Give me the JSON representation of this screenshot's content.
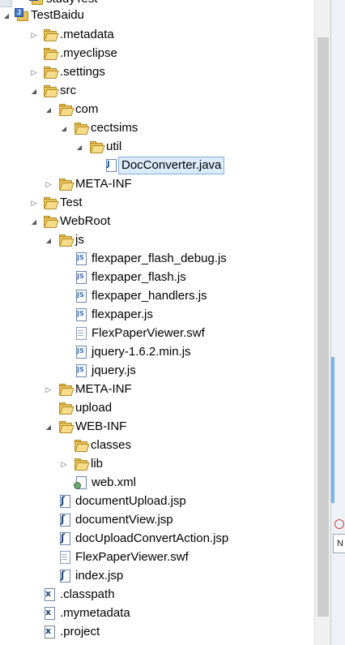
{
  "tree": {
    "partial_top_item": "studyTest",
    "items": [
      {
        "label": "TestBaidu",
        "icon": "project-icon",
        "state": "expanded"
      },
      {
        "label": ".metadata",
        "icon": "folder-icon",
        "state": "collapsed"
      },
      {
        "label": ".myeclipse",
        "icon": "folder-icon",
        "state": "none"
      },
      {
        "label": ".settings",
        "icon": "folder-icon",
        "state": "collapsed"
      },
      {
        "label": "src",
        "icon": "folder-icon",
        "state": "expanded"
      },
      {
        "label": "com",
        "icon": "folder-icon",
        "state": "expanded"
      },
      {
        "label": "cectsims",
        "icon": "folder-icon",
        "state": "expanded"
      },
      {
        "label": "util",
        "icon": "folder-icon",
        "state": "expanded"
      },
      {
        "label": "DocConverter.java",
        "icon": "java-file-icon",
        "state": "none",
        "selected": true
      },
      {
        "label": "META-INF",
        "icon": "folder-icon",
        "state": "collapsed"
      },
      {
        "label": "Test",
        "icon": "folder-icon",
        "state": "collapsed"
      },
      {
        "label": "WebRoot",
        "icon": "folder-icon",
        "state": "expanded"
      },
      {
        "label": "js",
        "icon": "folder-icon",
        "state": "expanded"
      },
      {
        "label": "flexpaper_flash_debug.js",
        "icon": "js-file-icon",
        "state": "none"
      },
      {
        "label": "flexpaper_flash.js",
        "icon": "js-file-icon",
        "state": "none"
      },
      {
        "label": "flexpaper_handlers.js",
        "icon": "js-file-icon",
        "state": "none"
      },
      {
        "label": "flexpaper.js",
        "icon": "js-file-icon",
        "state": "none"
      },
      {
        "label": "FlexPaperViewer.swf",
        "icon": "swf-file-icon",
        "state": "none"
      },
      {
        "label": "jquery-1.6.2.min.js",
        "icon": "js-file-icon",
        "state": "none"
      },
      {
        "label": "jquery.js",
        "icon": "js-file-icon",
        "state": "none"
      },
      {
        "label": "META-INF",
        "icon": "folder-icon",
        "state": "collapsed"
      },
      {
        "label": "upload",
        "icon": "folder-icon",
        "state": "none"
      },
      {
        "label": "WEB-INF",
        "icon": "folder-icon",
        "state": "expanded"
      },
      {
        "label": "classes",
        "icon": "folder-icon",
        "state": "none"
      },
      {
        "label": "lib",
        "icon": "folder-icon",
        "state": "collapsed"
      },
      {
        "label": "web.xml",
        "icon": "xml-file-icon",
        "state": "none"
      },
      {
        "label": "documentUpload.jsp",
        "icon": "jsp-file-icon",
        "state": "none"
      },
      {
        "label": "documentView.jsp",
        "icon": "jsp-file-icon",
        "state": "none"
      },
      {
        "label": "docUploadConvertAction.jsp",
        "icon": "jsp-file-icon",
        "state": "none"
      },
      {
        "label": "FlexPaperViewer.swf",
        "icon": "swf-file-icon",
        "state": "none"
      },
      {
        "label": "index.jsp",
        "icon": "jsp-file-icon",
        "state": "none"
      },
      {
        "label": ".classpath",
        "icon": "x-file-icon",
        "state": "none"
      },
      {
        "label": ".mymetadata",
        "icon": "x-file-icon",
        "state": "none"
      },
      {
        "label": ".project",
        "icon": "x-file-icon",
        "state": "none"
      }
    ]
  },
  "right_panel": {
    "partial_text": "N"
  },
  "colors": {
    "selection_bg": "#dcebfc",
    "selection_border": "#84acdd",
    "folder": "#e8c35a"
  }
}
